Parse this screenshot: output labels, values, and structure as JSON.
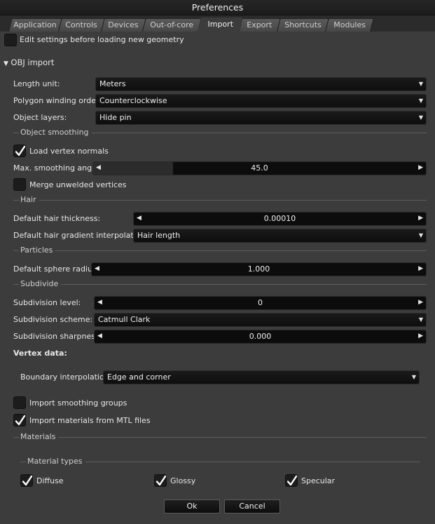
{
  "window": {
    "title": "Preferences"
  },
  "tabs": [
    "Application",
    "Controls",
    "Devices",
    "Out-of-core",
    "Import",
    "Export",
    "Shortcuts",
    "Modules"
  ],
  "active_tab": "Import",
  "edit_before_loading": {
    "label": "Edit settings before loading new geometry",
    "checked": false
  },
  "obj_import": {
    "header": "OBJ import",
    "length_unit": {
      "label": "Length unit:",
      "value": "Meters"
    },
    "winding_order": {
      "label": "Polygon winding order:",
      "value": "Counterclockwise"
    },
    "object_layers": {
      "label": "Object layers:",
      "value": "Hide pin"
    },
    "object_smoothing": {
      "section": "Object smoothing",
      "load_vertex_normals": {
        "label": "Load vertex normals",
        "checked": true
      },
      "max_smoothing_angle": {
        "label": "Max. smoothing angle:",
        "value": "45.0",
        "fill_fraction": 0.24
      },
      "merge_unwelded": {
        "label": "Merge unwelded vertices",
        "checked": false
      }
    },
    "hair": {
      "section": "Hair",
      "thickness": {
        "label": "Default hair thickness:",
        "value": "0.00010"
      },
      "gradient": {
        "label": "Default hair gradient interpolation:",
        "value": "Hair length"
      }
    },
    "particles": {
      "section": "Particles",
      "sphere_radius": {
        "label": "Default sphere radius:",
        "value": "1.000"
      }
    },
    "subdivide": {
      "section": "Subdivide",
      "level": {
        "label": "Subdivision level:",
        "value": "0"
      },
      "scheme": {
        "label": "Subdivision scheme:",
        "value": "Catmull Clark"
      },
      "sharpness": {
        "label": "Subdivision sharpness:",
        "value": "0.000"
      },
      "vertex_data": "Vertex data:",
      "boundary": {
        "label": "Boundary interpolation:",
        "value": "Edge and corner"
      }
    },
    "import_smoothing_groups": {
      "label": "Import smoothing groups",
      "checked": false
    },
    "import_mtl": {
      "label": "Import materials from MTL files",
      "checked": true
    },
    "materials": {
      "section": "Materials",
      "types_section": "Material types",
      "diffuse": {
        "label": "Diffuse",
        "checked": true
      },
      "glossy": {
        "label": "Glossy",
        "checked": true
      },
      "specular": {
        "label": "Specular",
        "checked": true
      }
    }
  },
  "buttons": {
    "ok": "Ok",
    "cancel": "Cancel"
  },
  "icons": {
    "dropdown": "triangle-down-icon",
    "slider_left": "triangle-left-icon",
    "slider_right": "triangle-right-icon",
    "collapse": "triangle-down-icon",
    "check": "check-icon"
  },
  "colors": {
    "background": "#3c3c3c",
    "field": "#101010",
    "tab_inactive": "#4f4f4f",
    "titlebar": "#222222"
  }
}
